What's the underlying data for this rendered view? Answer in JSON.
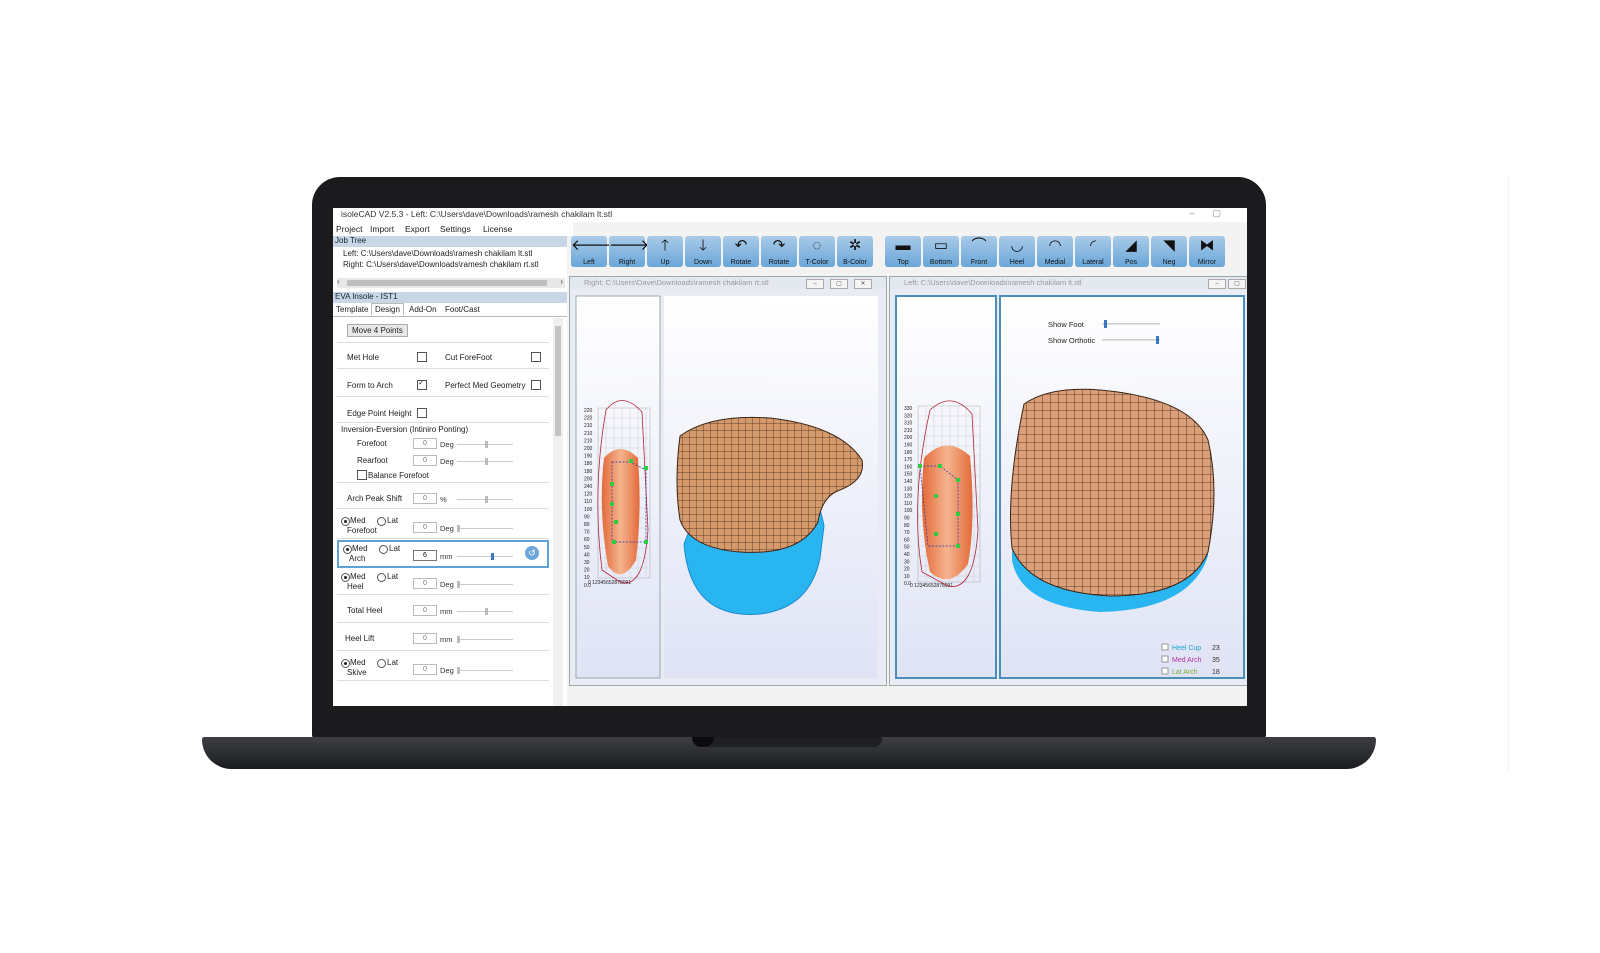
{
  "window": {
    "title": "isoleCAD V2.5.3 - Left: C:\\Users\\dave\\Downloads\\ramesh  chakilam  lt.stl"
  },
  "menu": [
    "Project",
    "Import",
    "Export",
    "Settings",
    "License"
  ],
  "job_tree": {
    "header": "Job Tree",
    "items": [
      "Left: C:\\Users\\dave\\Downloads\\ramesh  chakilam  lt.stl",
      "Right: C:\\Users\\dave\\Downloads\\ramesh  chakilam  rt.stl"
    ]
  },
  "design_panel": {
    "header": "EVA Insole - IST1",
    "tabs": [
      "Template",
      "Design",
      "Add-On",
      "Foot/Cast"
    ],
    "active_tab": "Design",
    "move_button": "Move 4 Points",
    "met_hole": "Met Hole",
    "cut_forefoot": "Cut ForeFoot",
    "form_to_arch": "Form to Arch",
    "perfect_med": "Perfect Med Geometry",
    "edge_point": "Edge Point Height",
    "inversion_group": "Inversion-Eversion (Intiniro Ponting)",
    "forefoot": "Forefoot",
    "rearfoot": "Rearfoot",
    "balance": "Balance Forefoot",
    "arch_peak": "Arch Peak Shift",
    "med": "Med",
    "lat": "Lat",
    "forefoot_sub": "Forefoot",
    "arch_sub": "Arch",
    "heel_sub": "Heel",
    "total_heel": "Total Heel",
    "heel_lift": "Heel Lift",
    "skive_sub": "Skive",
    "zero": "0",
    "arch_value": "6",
    "deg": "Deg",
    "pct": "%",
    "mm": "mm"
  },
  "toolbar": [
    "Left",
    "Right",
    "Up",
    "Down",
    "Rotate",
    "Rotate",
    "T-Color",
    "B-Color",
    "Top",
    "Bottom",
    "Front",
    "Heel",
    "Medial",
    "Lateral",
    "Pos",
    "Neg",
    "Mirror"
  ],
  "icons": [
    "arrow-left-icon",
    "arrow-right-icon",
    "arrow-up-icon",
    "arrow-down-icon",
    "rotate-ccw-icon",
    "rotate-cw-icon",
    "top-color-icon",
    "bottom-color-icon",
    "top-view-icon",
    "bottom-view-icon",
    "front-view-icon",
    "heel-view-icon",
    "medial-view-icon",
    "lateral-view-icon",
    "positive-icon",
    "negative-icon",
    "mirror-icon"
  ],
  "right_view": {
    "title": "Right: C:\\Users\\Dave\\Downloads\\ramesh  chakilam  rt.stl"
  },
  "left_view": {
    "title": "Left: C:\\Users\\dave\\Downloads\\ramesh  chakilam  lt.stl",
    "show_foot": "Show Foot",
    "show_orthotic": "Show Orthotic",
    "legend": [
      {
        "label": "Heel Cup",
        "value": "23",
        "color": "#1aa7c9"
      },
      {
        "label": "Med Arch",
        "value": "35",
        "color": "#b1329a"
      },
      {
        "label": "Lat Arch",
        "value": "18",
        "color": "#7cae3a"
      }
    ]
  },
  "grid_scale_right": [
    "220",
    "220",
    "210",
    "210",
    "210",
    "200",
    "190",
    "180",
    "180",
    "200",
    "240",
    "120",
    "110",
    "100",
    "90",
    "80",
    "70",
    "60",
    "50",
    "40",
    "30",
    "20",
    "10",
    "0.0"
  ],
  "grid_scale_left": [
    "330",
    "320",
    "310",
    "210",
    "200",
    "190",
    "180",
    "170",
    "160",
    "150",
    "140",
    "130",
    "120",
    "110",
    "100",
    "90",
    "80",
    "70",
    "60",
    "50",
    "40",
    "30",
    "20",
    "10",
    "0.0"
  ],
  "grid_x_right": "0 12345652878091",
  "grid_x_left": "0 12345652878091",
  "colors": {
    "accent": "#6aa6d8",
    "insole_top": "#c98a5e",
    "insole_shell": "#29b6f0"
  }
}
